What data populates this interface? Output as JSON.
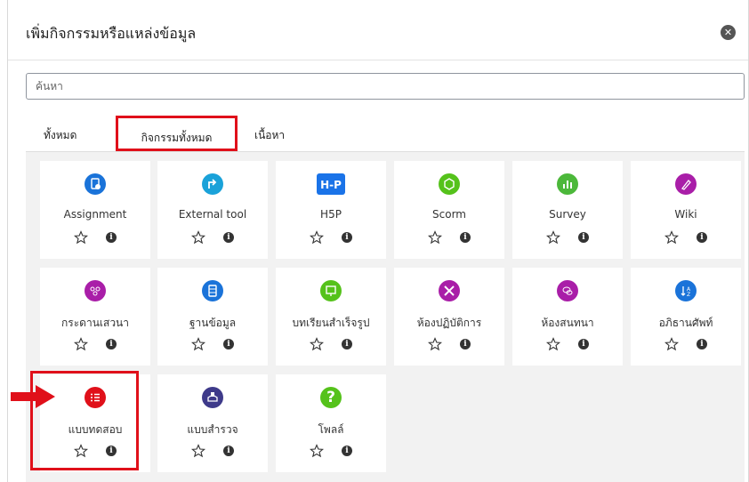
{
  "dialog": {
    "title": "เพิ่มกิจกรรมหรือแหล่งข้อมูล",
    "close_glyph": "✕"
  },
  "search": {
    "placeholder": "ค้นหา"
  },
  "tabs": [
    {
      "label": "ทั้งหมด"
    },
    {
      "label": "กิจกรรมทั้งหมด",
      "active": true,
      "highlighted": true
    },
    {
      "label": "เนื้อหา"
    }
  ],
  "tiles": [
    {
      "label": "Assignment",
      "icon": "assignment-icon",
      "color": "#1a73d9"
    },
    {
      "label": "External tool",
      "icon": "external-tool-icon",
      "color": "#1aa2d9"
    },
    {
      "label": "H5P",
      "icon": "h5p-icon",
      "color": "#1a73e8"
    },
    {
      "label": "Scorm",
      "icon": "scorm-icon",
      "color": "#55c21b"
    },
    {
      "label": "Survey",
      "icon": "survey-icon",
      "color": "#4cb83a"
    },
    {
      "label": "Wiki",
      "icon": "wiki-icon",
      "color": "#a91ea8"
    },
    {
      "label": "กระดานเสวนา",
      "icon": "forum-icon",
      "color": "#a91ea8"
    },
    {
      "label": "ฐานข้อมูล",
      "icon": "database-icon",
      "color": "#1a73d9"
    },
    {
      "label": "บทเรียนสำเร็จรูป",
      "icon": "lesson-icon",
      "color": "#55c21b"
    },
    {
      "label": "ห้องปฏิบัติการ",
      "icon": "workshop-icon",
      "color": "#a91ea8"
    },
    {
      "label": "ห้องสนทนา",
      "icon": "chat-icon",
      "color": "#a91ea8"
    },
    {
      "label": "อภิธานศัพท์",
      "icon": "glossary-icon",
      "color": "#1a73d9"
    },
    {
      "label": "แบบทดสอบ",
      "icon": "quiz-icon",
      "color": "#e0101a",
      "highlighted": true
    },
    {
      "label": "แบบสำรวจ",
      "icon": "feedback-icon",
      "color": "#3e3a8a"
    },
    {
      "label": "โพลล์",
      "icon": "choice-icon",
      "color": "#55c21b",
      "glyph": "?"
    }
  ],
  "info_glyph": "i",
  "colors": {
    "highlight": "#e0101a",
    "background": "#f2f2f2"
  }
}
